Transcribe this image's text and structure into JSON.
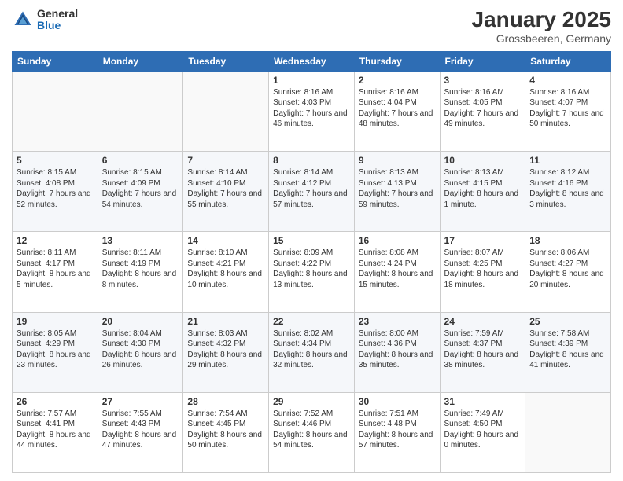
{
  "logo": {
    "general": "General",
    "blue": "Blue"
  },
  "title": "January 2025",
  "subtitle": "Grossbeeren, Germany",
  "headers": [
    "Sunday",
    "Monday",
    "Tuesday",
    "Wednesday",
    "Thursday",
    "Friday",
    "Saturday"
  ],
  "weeks": [
    [
      {
        "day": "",
        "info": ""
      },
      {
        "day": "",
        "info": ""
      },
      {
        "day": "",
        "info": ""
      },
      {
        "day": "1",
        "info": "Sunrise: 8:16 AM\nSunset: 4:03 PM\nDaylight: 7 hours and 46 minutes."
      },
      {
        "day": "2",
        "info": "Sunrise: 8:16 AM\nSunset: 4:04 PM\nDaylight: 7 hours and 48 minutes."
      },
      {
        "day": "3",
        "info": "Sunrise: 8:16 AM\nSunset: 4:05 PM\nDaylight: 7 hours and 49 minutes."
      },
      {
        "day": "4",
        "info": "Sunrise: 8:16 AM\nSunset: 4:07 PM\nDaylight: 7 hours and 50 minutes."
      }
    ],
    [
      {
        "day": "5",
        "info": "Sunrise: 8:15 AM\nSunset: 4:08 PM\nDaylight: 7 hours and 52 minutes."
      },
      {
        "day": "6",
        "info": "Sunrise: 8:15 AM\nSunset: 4:09 PM\nDaylight: 7 hours and 54 minutes."
      },
      {
        "day": "7",
        "info": "Sunrise: 8:14 AM\nSunset: 4:10 PM\nDaylight: 7 hours and 55 minutes."
      },
      {
        "day": "8",
        "info": "Sunrise: 8:14 AM\nSunset: 4:12 PM\nDaylight: 7 hours and 57 minutes."
      },
      {
        "day": "9",
        "info": "Sunrise: 8:13 AM\nSunset: 4:13 PM\nDaylight: 7 hours and 59 minutes."
      },
      {
        "day": "10",
        "info": "Sunrise: 8:13 AM\nSunset: 4:15 PM\nDaylight: 8 hours and 1 minute."
      },
      {
        "day": "11",
        "info": "Sunrise: 8:12 AM\nSunset: 4:16 PM\nDaylight: 8 hours and 3 minutes."
      }
    ],
    [
      {
        "day": "12",
        "info": "Sunrise: 8:11 AM\nSunset: 4:17 PM\nDaylight: 8 hours and 5 minutes."
      },
      {
        "day": "13",
        "info": "Sunrise: 8:11 AM\nSunset: 4:19 PM\nDaylight: 8 hours and 8 minutes."
      },
      {
        "day": "14",
        "info": "Sunrise: 8:10 AM\nSunset: 4:21 PM\nDaylight: 8 hours and 10 minutes."
      },
      {
        "day": "15",
        "info": "Sunrise: 8:09 AM\nSunset: 4:22 PM\nDaylight: 8 hours and 13 minutes."
      },
      {
        "day": "16",
        "info": "Sunrise: 8:08 AM\nSunset: 4:24 PM\nDaylight: 8 hours and 15 minutes."
      },
      {
        "day": "17",
        "info": "Sunrise: 8:07 AM\nSunset: 4:25 PM\nDaylight: 8 hours and 18 minutes."
      },
      {
        "day": "18",
        "info": "Sunrise: 8:06 AM\nSunset: 4:27 PM\nDaylight: 8 hours and 20 minutes."
      }
    ],
    [
      {
        "day": "19",
        "info": "Sunrise: 8:05 AM\nSunset: 4:29 PM\nDaylight: 8 hours and 23 minutes."
      },
      {
        "day": "20",
        "info": "Sunrise: 8:04 AM\nSunset: 4:30 PM\nDaylight: 8 hours and 26 minutes."
      },
      {
        "day": "21",
        "info": "Sunrise: 8:03 AM\nSunset: 4:32 PM\nDaylight: 8 hours and 29 minutes."
      },
      {
        "day": "22",
        "info": "Sunrise: 8:02 AM\nSunset: 4:34 PM\nDaylight: 8 hours and 32 minutes."
      },
      {
        "day": "23",
        "info": "Sunrise: 8:00 AM\nSunset: 4:36 PM\nDaylight: 8 hours and 35 minutes."
      },
      {
        "day": "24",
        "info": "Sunrise: 7:59 AM\nSunset: 4:37 PM\nDaylight: 8 hours and 38 minutes."
      },
      {
        "day": "25",
        "info": "Sunrise: 7:58 AM\nSunset: 4:39 PM\nDaylight: 8 hours and 41 minutes."
      }
    ],
    [
      {
        "day": "26",
        "info": "Sunrise: 7:57 AM\nSunset: 4:41 PM\nDaylight: 8 hours and 44 minutes."
      },
      {
        "day": "27",
        "info": "Sunrise: 7:55 AM\nSunset: 4:43 PM\nDaylight: 8 hours and 47 minutes."
      },
      {
        "day": "28",
        "info": "Sunrise: 7:54 AM\nSunset: 4:45 PM\nDaylight: 8 hours and 50 minutes."
      },
      {
        "day": "29",
        "info": "Sunrise: 7:52 AM\nSunset: 4:46 PM\nDaylight: 8 hours and 54 minutes."
      },
      {
        "day": "30",
        "info": "Sunrise: 7:51 AM\nSunset: 4:48 PM\nDaylight: 8 hours and 57 minutes."
      },
      {
        "day": "31",
        "info": "Sunrise: 7:49 AM\nSunset: 4:50 PM\nDaylight: 9 hours and 0 minutes."
      },
      {
        "day": "",
        "info": ""
      }
    ]
  ]
}
